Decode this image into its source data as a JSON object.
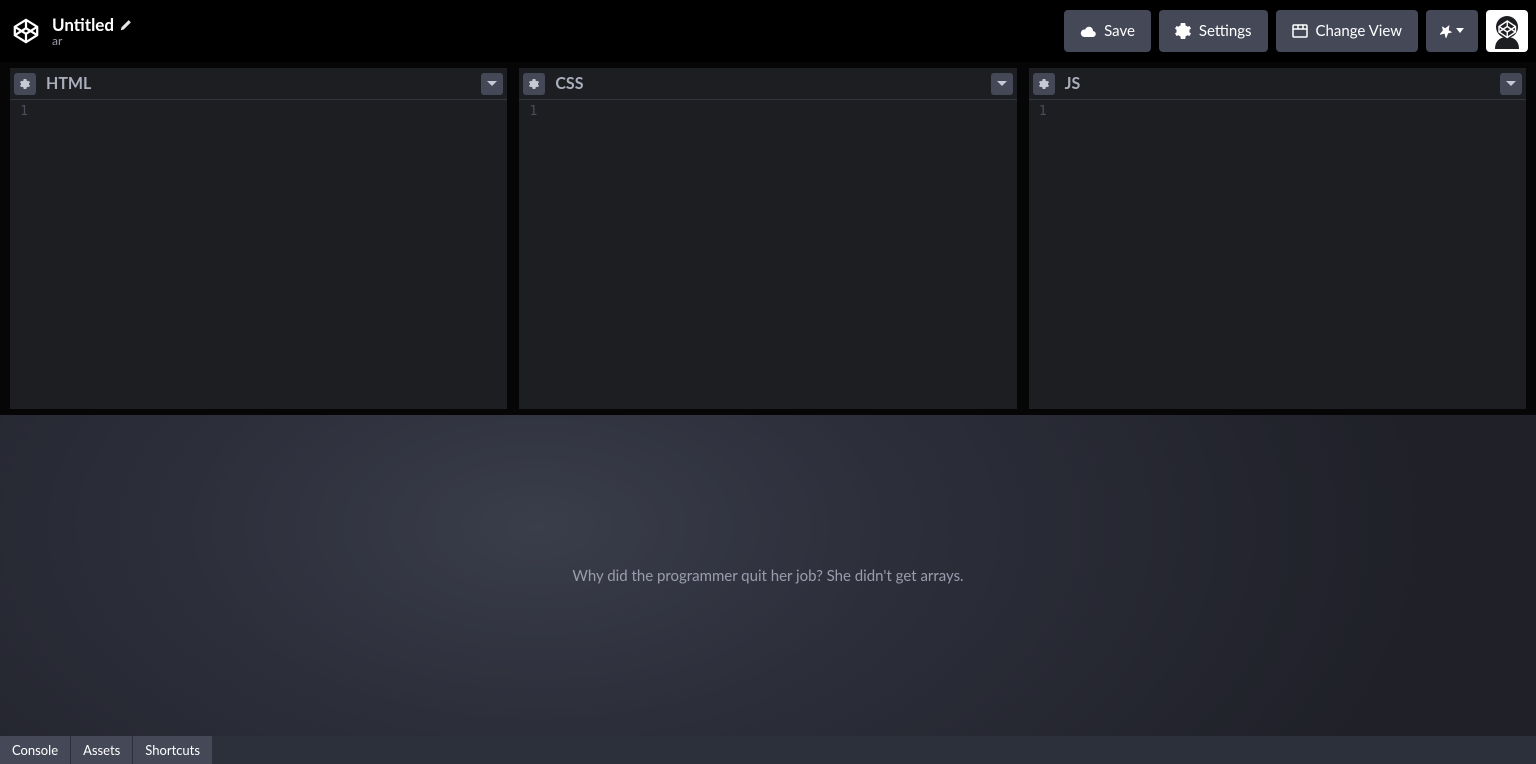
{
  "header": {
    "title": "Untitled",
    "author": "ar",
    "buttons": {
      "save": "Save",
      "settings": "Settings",
      "change_view": "Change View"
    }
  },
  "panels": {
    "html": {
      "title": "HTML",
      "line_number": "1"
    },
    "css": {
      "title": "CSS",
      "line_number": "1"
    },
    "js": {
      "title": "JS",
      "line_number": "1"
    }
  },
  "preview": {
    "placeholder_text": "Why did the programmer quit her job? She didn't get arrays."
  },
  "footer": {
    "console": "Console",
    "assets": "Assets",
    "shortcuts": "Shortcuts"
  }
}
